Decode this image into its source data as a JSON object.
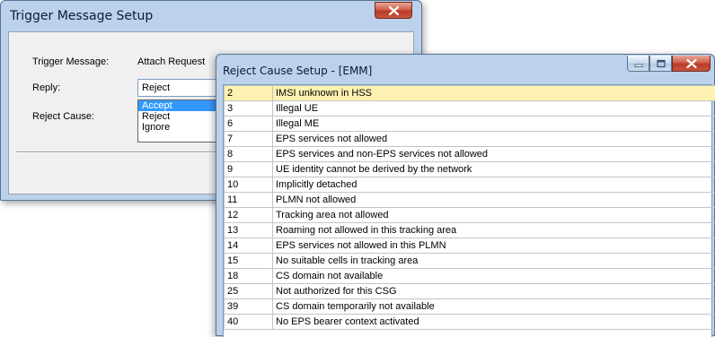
{
  "trigger_window": {
    "title": "Trigger Message Setup",
    "trigger_message_label": "Trigger Message:",
    "trigger_message_value": "Attach Request",
    "reply_label": "Reply:",
    "reply_value": "Reject",
    "reply_options": [
      "Accept",
      "Reject",
      "Ignore"
    ],
    "reply_highlighted": "Accept",
    "reject_cause_label": "Reject Cause:"
  },
  "reject_window": {
    "title": "Reject Cause Setup - [EMM]",
    "selected_code": "2",
    "rows": [
      {
        "code": "2",
        "text": "IMSI unknown in HSS"
      },
      {
        "code": "3",
        "text": "Illegal UE"
      },
      {
        "code": "6",
        "text": "Illegal ME"
      },
      {
        "code": "7",
        "text": "EPS services not allowed"
      },
      {
        "code": "8",
        "text": "EPS services and non-EPS services not allowed"
      },
      {
        "code": "9",
        "text": "UE identity cannot be derived by the network"
      },
      {
        "code": "10",
        "text": "Implicitly detached"
      },
      {
        "code": "11",
        "text": "PLMN not allowed"
      },
      {
        "code": "12",
        "text": "Tracking area not allowed"
      },
      {
        "code": "13",
        "text": "Roaming not allowed in this tracking area"
      },
      {
        "code": "14",
        "text": "EPS services not allowed in this PLMN"
      },
      {
        "code": "15",
        "text": "No suitable cells in tracking area"
      },
      {
        "code": "18",
        "text": "CS domain not available"
      },
      {
        "code": "25",
        "text": "Not authorized for this CSG"
      },
      {
        "code": "39",
        "text": "CS domain temporarily not available"
      },
      {
        "code": "40",
        "text": "No EPS bearer context activated"
      }
    ]
  },
  "colors": {
    "window_frame": "#bcd2ea",
    "selection": "#3399ff",
    "selected_row": "#fdf2b2",
    "close_button": "#c9553f"
  }
}
